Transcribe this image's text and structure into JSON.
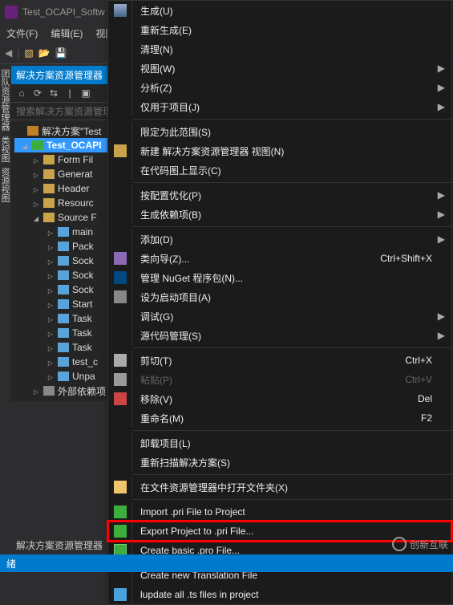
{
  "titlebar": {
    "project_name": "Test_OCAPI_Softw"
  },
  "menubar": {
    "file": "文件(F)",
    "edit": "编辑(E)",
    "view": "视图"
  },
  "panel": {
    "header": "解决方案资源管理器",
    "search_placeholder": "搜索解决方案资源管理器",
    "footer": "解决方案资源管理器"
  },
  "tree": {
    "solution": "解决方案\"Test",
    "project": "Test_OCAPI",
    "items": [
      "Form Fil",
      "Generat",
      "Header",
      "Resourc"
    ],
    "source": "Source F",
    "source_items": [
      "main",
      "Pack",
      "Sock",
      "Sock",
      "Sock",
      "Start",
      "Task",
      "Task",
      "Task",
      "test_c",
      "Unpa"
    ],
    "ext": "外部依赖项"
  },
  "menu": {
    "build": "生成(U)",
    "rebuild": "重新生成(E)",
    "clean": "清理(N)",
    "view": "视图(W)",
    "analyze": "分析(Z)",
    "project_only": "仅用于项目(J)",
    "scope": "限定为此范围(S)",
    "new_explorer": "新建 解决方案资源管理器 视图(N)",
    "show_codemap": "在代码图上显示(C)",
    "profile_opt": "按配置优化(P)",
    "build_deps": "生成依赖项(B)",
    "add": "添加(D)",
    "class_wizard": "类向导(Z)...",
    "class_wizard_short": "Ctrl+Shift+X",
    "manage_nuget": "管理 NuGet 程序包(N)...",
    "set_startup": "设为启动项目(A)",
    "debug": "调试(G)",
    "source_control": "源代码管理(S)",
    "cut": "剪切(T)",
    "cut_short": "Ctrl+X",
    "paste": "粘贴(P)",
    "paste_short": "Ctrl+V",
    "remove": "移除(V)",
    "remove_short": "Del",
    "rename": "重命名(M)",
    "rename_short": "F2",
    "unload": "卸载项目(L)",
    "rescan": "重新扫描解决方案(S)",
    "open_explorer": "在文件资源管理器中打开文件夹(X)",
    "import_pri": "Import .pri File to Project",
    "export_pri": "Export Project to .pri File...",
    "create_pro": "Create basic .pro File...",
    "create_ts": "Create new Translation File",
    "lupdate": "lupdate all .ts files in project"
  },
  "status": {
    "text": "绪"
  },
  "watermark": {
    "text": "创新互联"
  }
}
